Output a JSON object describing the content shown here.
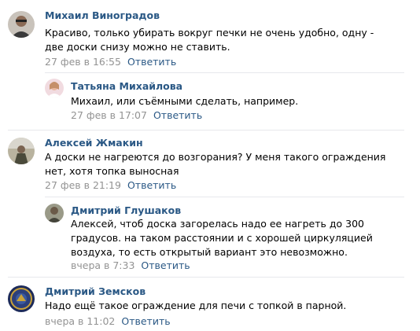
{
  "comments": [
    {
      "author": "Михаил Виноградов",
      "text": "Красиво, только убирать вокруг печки не очень удобно, одну - две доски снизу можно не ставить.",
      "date": "27 фев в 16:55",
      "reply": "Ответить"
    },
    {
      "author": "Татьяна Михайлова",
      "text": "Михаил, или съёмными сделать, например.",
      "date": "27 фев в 17:07",
      "reply": "Ответить"
    },
    {
      "author": "Алексей Жмакин",
      "text": "А доски не нагреются до возгорания? У меня такого ограждения нет, хотя топка выносная",
      "date": "27 фев в 21:19",
      "reply": "Ответить"
    },
    {
      "author": "Дмитрий Глушаков",
      "text": "Алексей, чтоб доска загорелась надо ее нагреть до 300 градусов. на таком расстоянии и с хорошей циркуляцией воздуха, то есть открытый вариант это невозможно.",
      "date": "вчера в 7:33",
      "reply": "Ответить"
    },
    {
      "author": "Дмитрий Земсков",
      "text": "Надо ещё такое ограждение для печи с топкой в парной.",
      "date": "вчера в 11:02",
      "reply": "Ответить"
    }
  ]
}
